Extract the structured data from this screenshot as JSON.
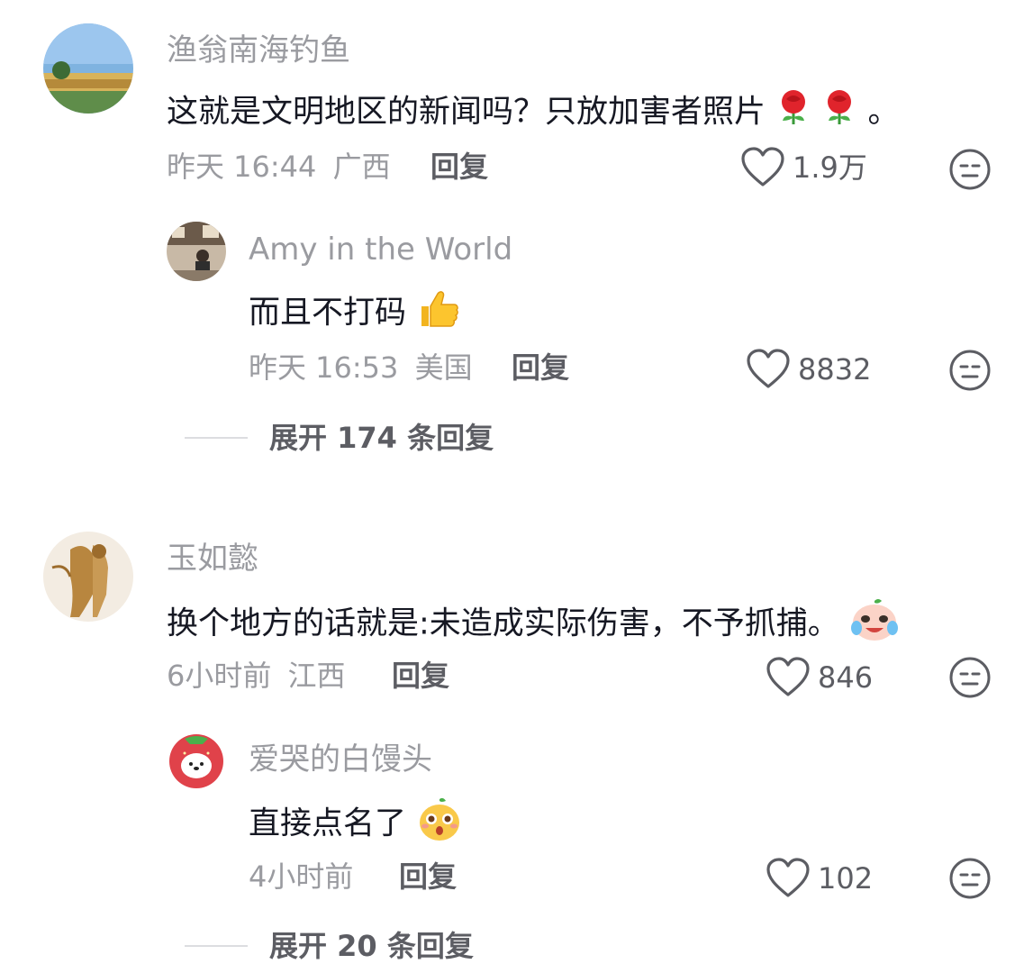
{
  "comments": [
    {
      "username": "渔翁南海钓鱼",
      "text": "这就是文明地区的新闻吗？只放加害者照片",
      "text_suffix": "。",
      "emoji": [
        "rose-icon",
        "rose-icon"
      ],
      "time": "昨天 16:44",
      "location": "广西",
      "reply_label": "回复",
      "likes": "1.9万",
      "replies": [
        {
          "username": "Amy in the World",
          "text": "而且不打码",
          "emoji": [
            "thumbs-up-icon"
          ],
          "time": "昨天 16:53",
          "location": "美国",
          "reply_label": "回复",
          "likes": "8832"
        }
      ],
      "expand_label": "展开 174 条回复"
    },
    {
      "username": "玉如懿",
      "text": "换个地方的话就是:未造成实际伤害，不予抓捕。",
      "emoji": [
        "crying-face-icon"
      ],
      "time": "6小时前",
      "location": "江西",
      "reply_label": "回复",
      "likes": "846",
      "replies": [
        {
          "username": "爱哭的白馒头",
          "text": "直接点名了",
          "emoji": [
            "surprised-face-icon"
          ],
          "time": "4小时前",
          "location": "",
          "reply_label": "回复",
          "likes": "102"
        }
      ],
      "expand_label": "展开 20 条回复"
    }
  ],
  "colors": {
    "text_primary": "#161823",
    "text_secondary": "#9a9ba0",
    "action_text": "#5c5d63",
    "background": "#ffffff"
  }
}
